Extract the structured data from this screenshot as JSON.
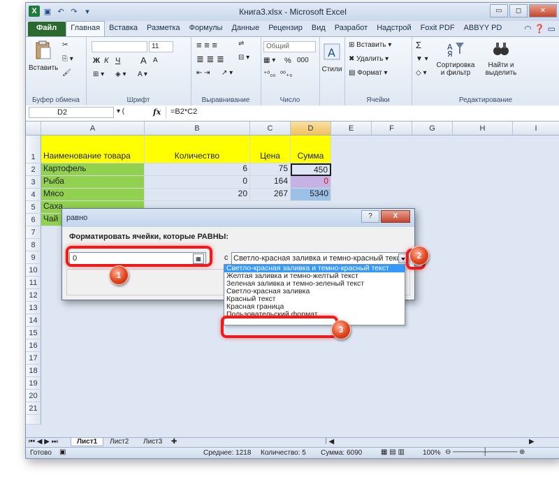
{
  "window": {
    "title": "Книга3.xlsx - Microsoft Excel",
    "controls": {
      "minimize": "▭",
      "maximize": "◻",
      "close": "✕"
    }
  },
  "ribbon_tabs": [
    "Файл",
    "Главная",
    "Вставка",
    "Разметка",
    "Формулы",
    "Данные",
    "Рецензир",
    "Вид",
    "Разработ",
    "Надстрой",
    "Foxit PDF",
    "ABBYY PD"
  ],
  "ribbon": {
    "clipboard": {
      "paste": "Вставить",
      "label": "Буфер обмена"
    },
    "font": {
      "size": "11",
      "bold": "Ж",
      "italic": "К",
      "underline": "Ч",
      "grow": "A",
      "shrink": "A",
      "label": "Шрифт"
    },
    "alignment": {
      "label": "Выравнивание"
    },
    "number": {
      "format": "Общий",
      "percent": "%",
      "thousands": "000",
      "dec_inc": "⁺⁰₀₀",
      "dec_dec": "⁰⁰₊₀",
      "label": "Число"
    },
    "styles": {
      "label": "Стили"
    },
    "cells": {
      "insert": "Вставить",
      "delete": "Удалить",
      "format": "Формат",
      "label": "Ячейки"
    },
    "editing": {
      "sum": "Σ",
      "sort_line1": "Сортировка",
      "sort_line2": "и фильтр",
      "find_line1": "Найти и",
      "find_line2": "выделить",
      "label": "Редактирование"
    }
  },
  "formula_bar": {
    "name_box": "D2",
    "fx": "fx",
    "formula": "=B2*C2"
  },
  "columns": [
    "A",
    "B",
    "C",
    "D",
    "E",
    "F",
    "G",
    "H",
    "I"
  ],
  "rows": [
    "1",
    "2",
    "3",
    "4",
    "5",
    "6",
    "7",
    "8",
    "9",
    "10",
    "11",
    "12",
    "13",
    "14",
    "15",
    "16",
    "17",
    "18",
    "19",
    "20",
    "21"
  ],
  "table": {
    "headers": [
      "Наименование товара",
      "Количество",
      "Цена",
      "Сумма"
    ],
    "rows": [
      [
        "Картофель",
        "6",
        "75",
        "450"
      ],
      [
        "Рыба",
        "0",
        "164",
        "0"
      ],
      [
        "Мясо",
        "20",
        "267",
        "5340"
      ],
      [
        "Саха",
        "",
        "",
        ""
      ],
      [
        "Чай",
        "",
        "",
        ""
      ]
    ]
  },
  "sheets": [
    "Лист1",
    "Лист2",
    "Лист3"
  ],
  "status": {
    "ready": "Готово",
    "average": "Среднее: 1218",
    "count": "Количество: 5",
    "sum": "Сумма: 6090",
    "zoom": "100%"
  },
  "dialog": {
    "title": "равно",
    "help": "?",
    "close": "X",
    "label": "Форматировать ячейки, которые РАВНЫ:",
    "value": "0",
    "with": "с",
    "selected_format": "Светло-красная заливка и темно-красный текст",
    "options": [
      "Светло-красная заливка и темно-красный текст",
      "Желтая заливка и темно-желтый текст",
      "Зеленая заливка и темно-зеленый текст",
      "Светло-красная заливка",
      "Красный текст",
      "Красная граница",
      "Пользовательский формат..."
    ]
  },
  "callouts": [
    "1",
    "2",
    "3"
  ],
  "colors": {
    "header_fill": "#ffff00",
    "name_fill": "#92d050",
    "red_fill": "#c5b3e6",
    "blue_fill": "#9bc2e6",
    "accent_red": "#ef1b1b",
    "selection": "#3399ff"
  }
}
